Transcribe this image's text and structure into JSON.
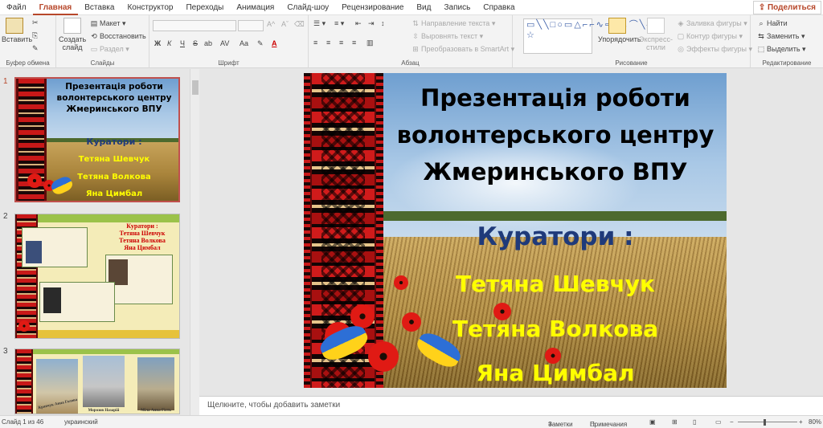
{
  "menubar": {
    "tabs": [
      "Файл",
      "Главная",
      "Вставка",
      "Конструктор",
      "Переходы",
      "Анимация",
      "Слайд-шоу",
      "Рецензирование",
      "Вид",
      "Запись",
      "Справка"
    ],
    "active_index": 1,
    "share_label": "Поделиться"
  },
  "ribbon": {
    "clipboard": {
      "paste_label": "Вставить",
      "group_label": "Буфер обмена"
    },
    "slides": {
      "new_slide_label": "Создать слайд",
      "layout_label": "Макет",
      "reset_label": "Восстановить",
      "section_label": "Раздел",
      "group_label": "Слайды"
    },
    "font": {
      "group_label": "Шрифт",
      "bold": "Ж",
      "italic": "К",
      "underline": "Ч",
      "strike": "S",
      "shadow": "ab",
      "spacing": "AV",
      "case": "Aa",
      "color": "A"
    },
    "paragraph": {
      "text_direction_label": "Направление текста",
      "align_text_label": "Выровнять текст",
      "smartart_label": "Преобразовать в SmartArt",
      "group_label": "Абзац"
    },
    "drawing": {
      "shapes_glyphs": "▭╲╲□○▭△⌐⌐∿⇨⇩↓⌒╲{}☆",
      "arrange_label": "Упорядочить",
      "quick_styles_label": "Экспресс-стили",
      "fill_label": "Заливка фигуры",
      "outline_label": "Контур фигуры",
      "effects_label": "Эффекты фигуры",
      "group_label": "Рисование"
    },
    "editing": {
      "find_label": "Найти",
      "replace_label": "Заменить",
      "select_label": "Выделить",
      "group_label": "Редактирование"
    }
  },
  "thumbnails": [
    {
      "number": "1",
      "selected": true
    },
    {
      "number": "2",
      "selected": false,
      "curators_title": "Куратори :",
      "names": [
        "Тетяна Шевчук",
        "Тетяна Волкова",
        "Яна Цимбал"
      ]
    },
    {
      "number": "3",
      "selected": false,
      "captions": [
        "Кравчук Анна Голова",
        "Морозов Назарій",
        "Міла Анна Гість"
      ]
    }
  ],
  "slide": {
    "title_lines": [
      "Презентація роботи",
      "волонтерського центру",
      "Жмеринського ВПУ"
    ],
    "curators_heading": "Куратори :",
    "curators": [
      "Тетяна Шевчук",
      "Тетяна Волкова",
      "Яна Цимбал"
    ],
    "colors": {
      "title": "#000000",
      "heading": "#1f3a7a",
      "names": "#ffff00"
    }
  },
  "notes": {
    "placeholder": "Щелкните, чтобы добавить заметки"
  },
  "status": {
    "slide_info": "Слайд 1 из 46",
    "language": "украинский",
    "notes_label": "Заметки",
    "comments_label": "Примечания",
    "zoom": "80%"
  }
}
